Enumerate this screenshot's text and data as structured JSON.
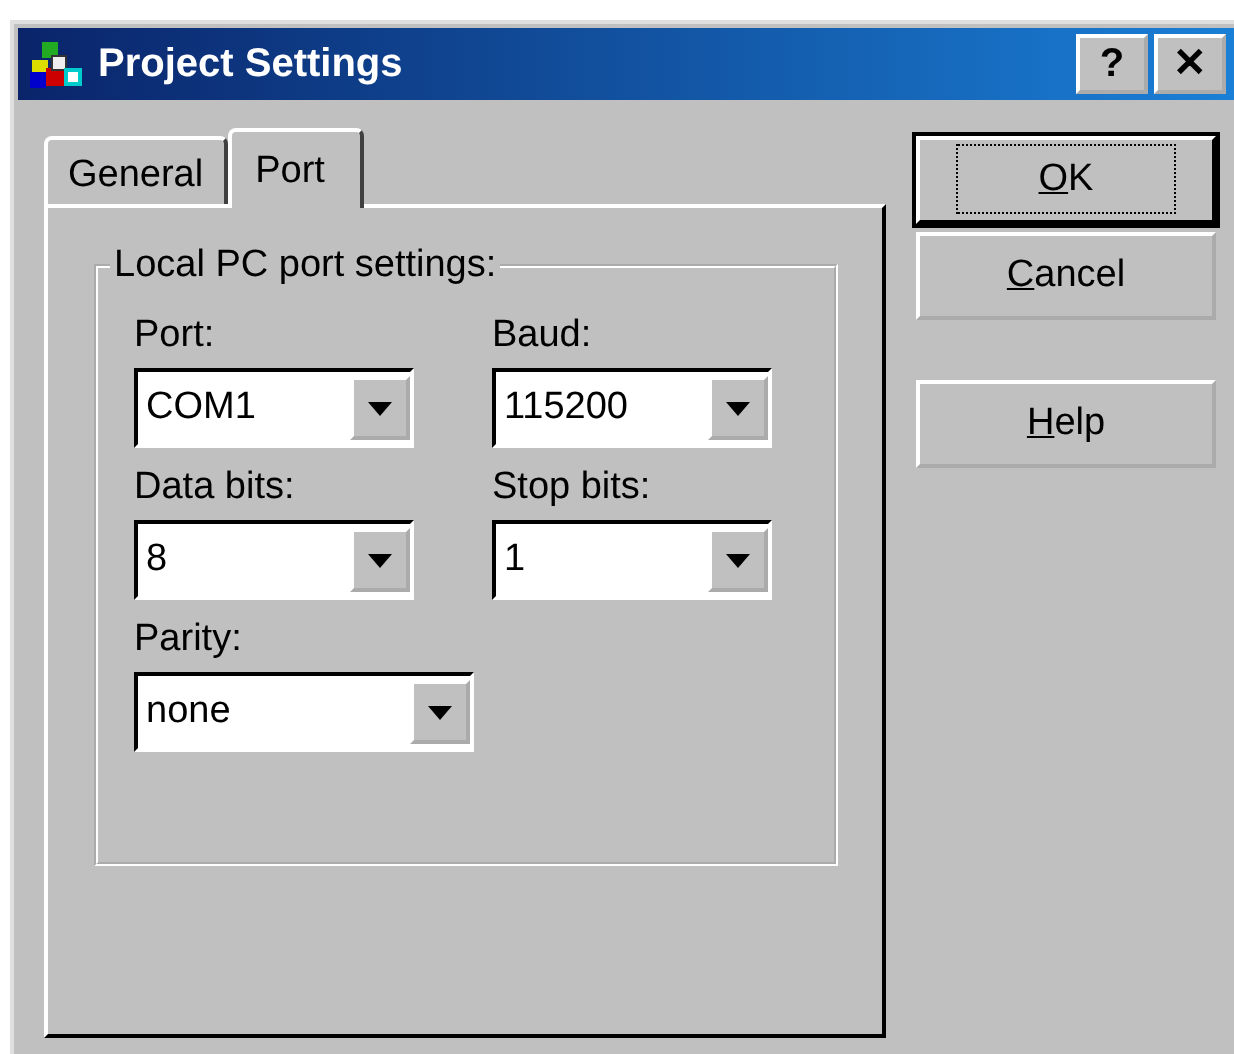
{
  "window": {
    "title": "Project Settings",
    "title_buttons": [
      "?",
      "✕"
    ]
  },
  "tabs": [
    {
      "label": "General",
      "selected": false
    },
    {
      "label": "Port",
      "selected": true
    }
  ],
  "group": {
    "title": "Local PC port settings:",
    "fields": [
      {
        "label": "Port:",
        "value": "COM1"
      },
      {
        "label": "Baud:",
        "value": "115200"
      },
      {
        "label": "Data bits:",
        "value": "8"
      },
      {
        "label": "Stop bits:",
        "value": "1"
      },
      {
        "label": "Parity:",
        "value": "none"
      }
    ]
  },
  "buttons": [
    {
      "mnemonic": "O",
      "rest": "K",
      "default": true
    },
    {
      "mnemonic": "C",
      "rest": "ancel",
      "default": false
    },
    {
      "mnemonic": "H",
      "rest": "elp",
      "default": false
    }
  ]
}
